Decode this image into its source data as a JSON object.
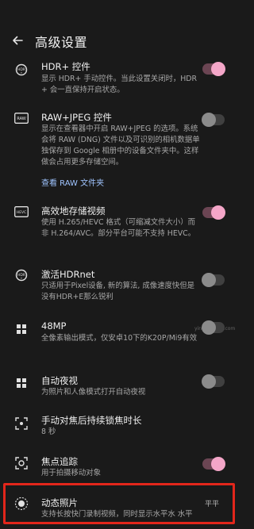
{
  "header": {
    "title": "高级设置",
    "back_icon": "arrow-left-icon"
  },
  "accent": "#f4a6c8",
  "highlight_color": "#e2261b",
  "watermark": "平平",
  "side_mark": "yingyun.xxx.com",
  "items": [
    {
      "key": "hdr",
      "icon": "hdr-icon",
      "title": "HDR+ 控件",
      "desc": "显示 HDR+ 手动控件。当此设置关闭时，HDR+ 会一直保持开启状态。",
      "toggle": "on"
    },
    {
      "key": "raw",
      "icon": "raw-icon",
      "title": "RAW+JPEG 控件",
      "desc": "显示在查看器中开启 RAW+JPEG 的选项。系统会将 RAW (DNG) 文件以及可识别的相机数据单独保存到 Google 相册中的设备文件夹中。这样做会占用更多存储空间。",
      "link": "查看 RAW 文件夹",
      "toggle": "off"
    },
    {
      "key": "hevc",
      "icon": "hevc-icon",
      "title": "高效地存储视频",
      "desc": "使用 H.265/HEVC 格式（可缩减文件大小）而非 H.264/AVC。部分平台可能不支持 HEVC。",
      "toggle": "on"
    },
    {
      "key": "hdrnet",
      "icon": "hdrnet-icon",
      "title": "激活HDRnet",
      "desc": "只适用于Pixel设备, 新的算法, 成像速度快但是没有HDR+E那么锐利",
      "toggle": "off"
    },
    {
      "key": "48mp",
      "icon": "grid-icon",
      "title": "48MP",
      "desc": "全像素输出模式，仅安卓10下的K20P/Mi9有效",
      "toggle": "off"
    },
    {
      "key": "night",
      "icon": "grid-icon",
      "title": "自动夜视",
      "desc": "为照片和人像模式打开自动夜视",
      "toggle": "off"
    },
    {
      "key": "focus_lock",
      "icon": "focus-lock-icon",
      "title": "手动对焦后持续锁焦时长",
      "desc": "8 秒"
    },
    {
      "key": "tracking",
      "icon": "focus-tracking-icon",
      "title": "焦点追踪",
      "desc": "用于拍摄移动对象",
      "toggle": "on"
    },
    {
      "key": "motion",
      "icon": "motion-photo-icon",
      "title": "动态照片",
      "desc": "支持长按快门录制视频，同时显示水平水 水平"
    }
  ]
}
